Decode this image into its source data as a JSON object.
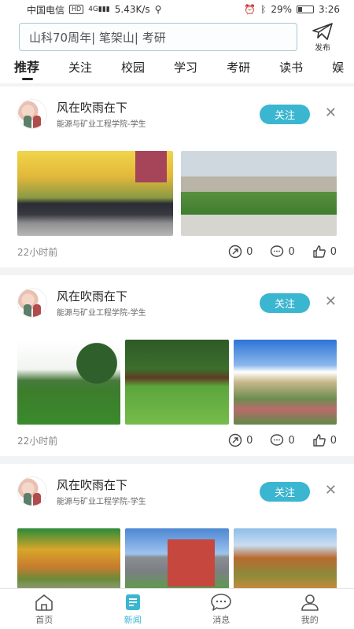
{
  "status_bar": {
    "carrier": "中国电信",
    "hd": "HD",
    "signal": "4G",
    "speed": "5.43K/s",
    "battery": "29%",
    "battery_level": 0.29,
    "time": "3:26"
  },
  "header": {
    "search_text": "山科70周年| 笔架山| 考研",
    "publish_label": "发布"
  },
  "tabs": [
    "推荐",
    "关注",
    "校园",
    "学习",
    "考研",
    "读书",
    "娱"
  ],
  "posts": [
    {
      "author": "风在吹雨在下",
      "dept": "能源与矿业工程学院-学生",
      "follow": "关注",
      "time": "22小时前",
      "shares": "0",
      "comments": "0",
      "likes": "0"
    },
    {
      "author": "风在吹雨在下",
      "dept": "能源与矿业工程学院-学生",
      "follow": "关注",
      "time": "22小时前",
      "shares": "0",
      "comments": "0",
      "likes": "0"
    },
    {
      "author": "风在吹雨在下",
      "dept": "能源与矿业工程学院-学生",
      "follow": "关注"
    }
  ],
  "tabbar": [
    {
      "label": "首页",
      "icon": "home-icon"
    },
    {
      "label": "新闻",
      "icon": "news-icon"
    },
    {
      "label": "消息",
      "icon": "message-icon"
    },
    {
      "label": "我的",
      "icon": "profile-icon"
    }
  ],
  "colors": {
    "accent": "#3bb6d0"
  }
}
